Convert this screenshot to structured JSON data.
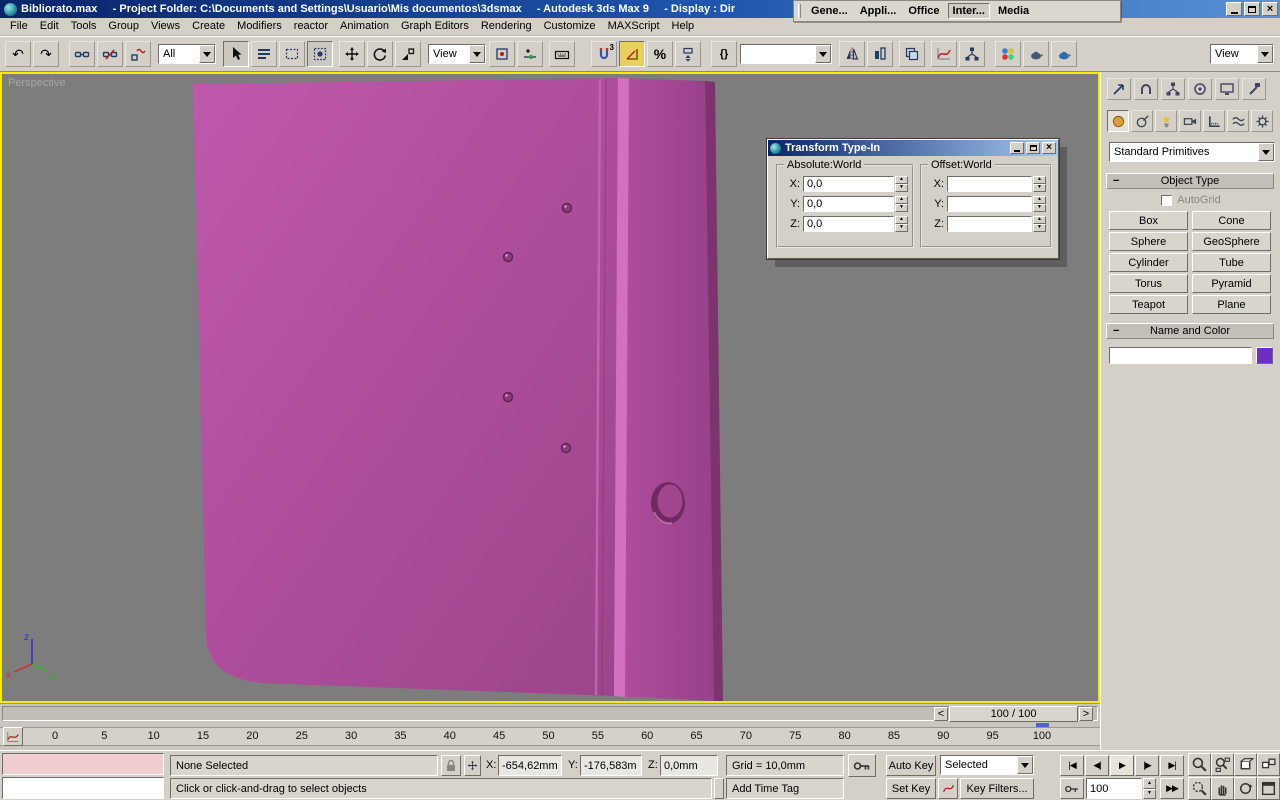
{
  "titlebar": {
    "title": "Bibliorato.max     - Project Folder: C:\\Documents and Settings\\Usuario\\Mis documentos\\3dsmax     - Autodesk 3ds Max 9     - Display : Dir"
  },
  "overlay_toolbar": {
    "items": [
      "Gene...",
      "Appli...",
      "Office",
      "Inter...",
      "Media"
    ]
  },
  "menubar": {
    "items": [
      "File",
      "Edit",
      "Tools",
      "Group",
      "Views",
      "Create",
      "Modifiers",
      "reactor",
      "Animation",
      "Graph Editors",
      "Rendering",
      "Customize",
      "MAXScript",
      "Help"
    ]
  },
  "toolbar": {
    "selection_filter": "All",
    "coord_system": "View",
    "views_label": "View",
    "named_sets_value": ""
  },
  "icons": {
    "undo": "↶",
    "redo": "↷",
    "snap_count": "3",
    "percent_snap": "%",
    "named_sets": "{}",
    "slider_left": "<",
    "slider_right": ">",
    "go_start": "|◀",
    "prev_frame": "◀|",
    "play": "▶",
    "next_frame": "|▶",
    "go_end": "▶|",
    "fast_forward": "▶▶"
  },
  "viewport": {
    "label": "Perspective",
    "axis": {
      "x": "x",
      "y": "y",
      "z": "z"
    }
  },
  "colors": {
    "object_magenta": "#b5509f",
    "viewport_border": "#f5ec00",
    "titlebar_blue": "#0a246a"
  },
  "transform_dialog": {
    "title": "Transform Type-In",
    "groups": {
      "absolute": {
        "label": "Absolute:World",
        "x_label": "X:",
        "y_label": "Y:",
        "z_label": "Z:",
        "x": "0,0",
        "y": "0,0",
        "z": "0,0"
      },
      "offset": {
        "label": "Offset:World",
        "x_label": "X:",
        "y_label": "Y:",
        "z_label": "Z:",
        "x": "",
        "y": "",
        "z": ""
      }
    }
  },
  "command_panel": {
    "primitive_category": "Standard Primitives",
    "object_type": {
      "title": "Object Type",
      "autogrid_label": "AutoGrid",
      "buttons": [
        "Box",
        "Cone",
        "Sphere",
        "GeoSphere",
        "Cylinder",
        "Tube",
        "Torus",
        "Pyramid",
        "Teapot",
        "Plane"
      ]
    },
    "name_color": {
      "title": "Name and Color",
      "name_value": "",
      "swatch_color": "#6d2fc2"
    }
  },
  "time_slider": {
    "value": "100 / 100"
  },
  "track_bar": {
    "ticks": [
      0,
      5,
      10,
      15,
      20,
      25,
      30,
      35,
      40,
      45,
      50,
      55,
      60,
      65,
      70,
      75,
      80,
      85,
      90,
      95,
      100
    ]
  },
  "status_bar": {
    "selection_status": "None Selected",
    "coords": {
      "x_label": "X:",
      "x": "-654,62mm",
      "y_label": "Y:",
      "y": "-176,583m",
      "z_label": "Z:",
      "z": "0,0mm"
    },
    "grid": "Grid = 10,0mm",
    "prompt": "Click or click-and-drag to select objects",
    "add_time_tag": "Add Time Tag",
    "auto_key": "Auto Key",
    "set_key": "Set Key",
    "key_mode_dropdown": "Selected",
    "key_filters": "Key Filters...",
    "frame_field": "100"
  }
}
